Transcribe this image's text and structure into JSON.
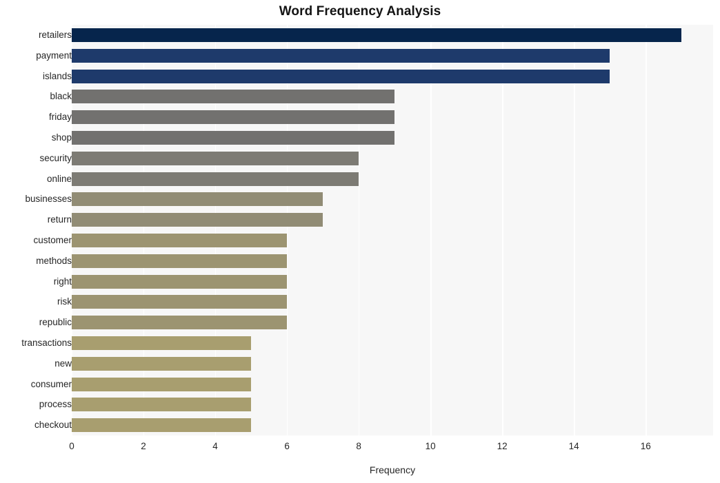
{
  "chart_data": {
    "type": "bar",
    "orientation": "horizontal",
    "title": "Word Frequency Analysis",
    "xlabel": "Frequency",
    "ylabel": "",
    "categories": [
      "retailers",
      "payment",
      "islands",
      "black",
      "friday",
      "shop",
      "security",
      "online",
      "businesses",
      "return",
      "customer",
      "methods",
      "right",
      "risk",
      "republic",
      "transactions",
      "new",
      "consumer",
      "process",
      "checkout"
    ],
    "values": [
      17,
      15,
      15,
      9,
      9,
      9,
      8,
      8,
      7,
      7,
      6,
      6,
      6,
      6,
      6,
      5,
      5,
      5,
      5,
      5
    ],
    "bar_colors": [
      "#06254c",
      "#1e3a6b",
      "#1e3a6b",
      "#72716f",
      "#72716f",
      "#72716f",
      "#7d7b74",
      "#7d7b74",
      "#918c75",
      "#918c75",
      "#9c9471",
      "#9c9471",
      "#9c9471",
      "#9c9471",
      "#9c9471",
      "#a89e6f",
      "#a89e6f",
      "#a89e6f",
      "#a89e6f",
      "#a89e6f"
    ],
    "xticks": [
      0,
      2,
      4,
      6,
      8,
      10,
      12,
      14,
      16
    ],
    "xtick_labels": [
      "0",
      "2",
      "4",
      "6",
      "8",
      "10",
      "12",
      "14",
      "16"
    ],
    "xlim": [
      0,
      17.88
    ],
    "grid": "vertical",
    "legend": "none",
    "plot_background": "#f7f7f7",
    "gridline_color": "#ffffff",
    "figure_background": "#ffffff"
  }
}
